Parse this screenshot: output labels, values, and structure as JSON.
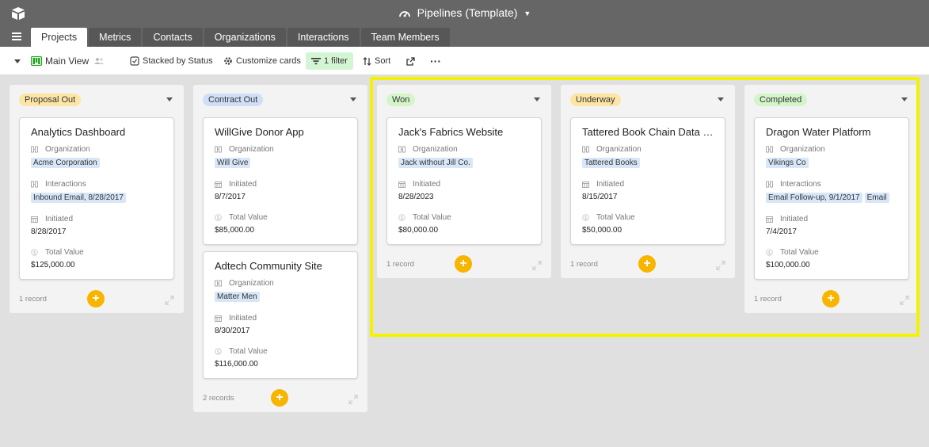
{
  "app": {
    "title": "Pipelines (Template)"
  },
  "tabs": [
    "Projects",
    "Metrics",
    "Contacts",
    "Organizations",
    "Interactions",
    "Team Members"
  ],
  "toolbar": {
    "view_name": "Main View",
    "stacked": "Stacked by Status",
    "customize": "Customize cards",
    "filter": "1 filter",
    "sort": "Sort"
  },
  "colors": {
    "accent_add": "#f7b500",
    "highlight": "#f3f300"
  },
  "columns": [
    {
      "status": "Proposal Out",
      "badge_color": "#fde5a6",
      "records": "1 record",
      "cards": [
        {
          "title": "Analytics Dashboard",
          "fields": [
            {
              "label": "Organization",
              "icon": "link-icon",
              "chips": [
                "Acme Corporation"
              ]
            },
            {
              "label": "Interactions",
              "icon": "link-icon",
              "chips": [
                "Inbound Email, 8/28/2017"
              ]
            },
            {
              "label": "Initiated",
              "icon": "calendar-icon",
              "value": "8/28/2017"
            },
            {
              "label": "Total Value",
              "icon": "currency-icon",
              "value": "$125,000.00"
            }
          ]
        }
      ]
    },
    {
      "status": "Contract Out",
      "badge_color": "#cfdff7",
      "records": "2 records",
      "cards": [
        {
          "title": "WillGive Donor App",
          "fields": [
            {
              "label": "Organization",
              "icon": "link-icon",
              "chips": [
                "Will Give"
              ]
            },
            {
              "label": "Initiated",
              "icon": "calendar-icon",
              "value": "8/7/2017"
            },
            {
              "label": "Total Value",
              "icon": "currency-icon",
              "value": "$85,000.00"
            }
          ]
        },
        {
          "title": "Adtech Community Site",
          "fields": [
            {
              "label": "Organization",
              "icon": "link-icon",
              "chips": [
                "Matter Men"
              ]
            },
            {
              "label": "Initiated",
              "icon": "calendar-icon",
              "value": "8/30/2017"
            },
            {
              "label": "Total Value",
              "icon": "currency-icon",
              "value": "$116,000.00"
            }
          ]
        }
      ]
    },
    {
      "status": "Won",
      "badge_color": "#d3f5c9",
      "records": "1 record",
      "cards": [
        {
          "title": "Jack's Fabrics Website",
          "fields": [
            {
              "label": "Organization",
              "icon": "link-icon",
              "chips": [
                "Jack without Jill Co."
              ]
            },
            {
              "label": "Initiated",
              "icon": "calendar-icon",
              "value": "8/28/2023"
            },
            {
              "label": "Total Value",
              "icon": "currency-icon",
              "value": "$80,000.00"
            }
          ]
        }
      ]
    },
    {
      "status": "Underway",
      "badge_color": "#fde5a6",
      "records": "1 record",
      "cards": [
        {
          "title": "Tattered Book Chain Data Migration",
          "fields": [
            {
              "label": "Organization",
              "icon": "link-icon",
              "chips": [
                "Tattered Books"
              ]
            },
            {
              "label": "Initiated",
              "icon": "calendar-icon",
              "value": "8/15/2017"
            },
            {
              "label": "Total Value",
              "icon": "currency-icon",
              "value": "$50,000.00"
            }
          ]
        }
      ]
    },
    {
      "status": "Completed",
      "badge_color": "#d3f5c9",
      "records": "1 record",
      "cards": [
        {
          "title": "Dragon Water Platform",
          "fields": [
            {
              "label": "Organization",
              "icon": "link-icon",
              "chips": [
                "Vikings Co"
              ]
            },
            {
              "label": "Interactions",
              "icon": "link-icon",
              "chips": [
                "Email Follow-up, 9/1/2017",
                "Email"
              ]
            },
            {
              "label": "Initiated",
              "icon": "calendar-icon",
              "value": "7/4/2017"
            },
            {
              "label": "Total Value",
              "icon": "currency-icon",
              "value": "$100,000.00"
            }
          ]
        }
      ]
    }
  ]
}
